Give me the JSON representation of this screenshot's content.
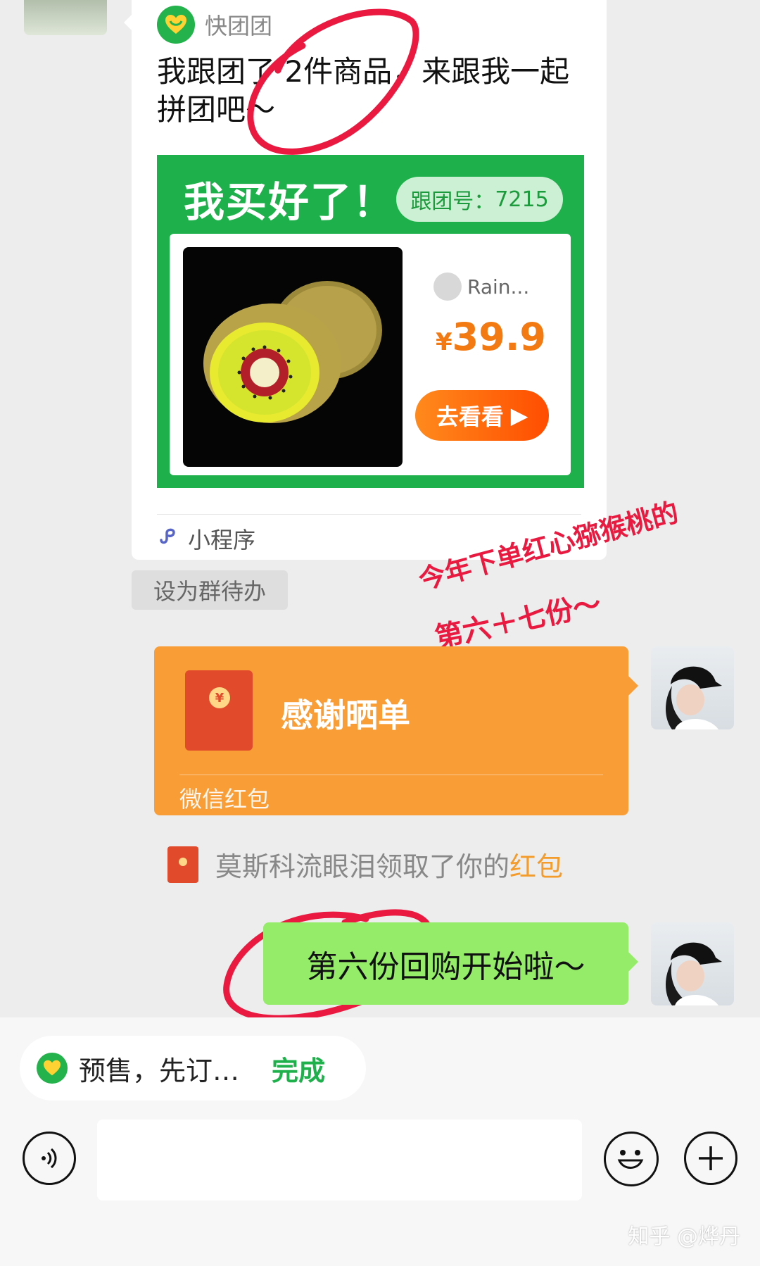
{
  "miniprogram_card": {
    "app_name": "快团团",
    "message": "我跟团了 2件商品，来跟我一起拼团吧～",
    "promo_title": "我买好了！",
    "group_number_label": "跟团号：",
    "group_number": "7215",
    "seller_name": "Rain...",
    "price_currency": "¥",
    "price": "39.9",
    "view_button": "去看看",
    "mini_program_label": "小程序",
    "product_image": "red-heart-kiwi-image"
  },
  "set_todo_label": "设为群待办",
  "annotation": {
    "line1": "今年下单红心猕猴桃的",
    "line2": "第六＋七份～",
    "color": "#e9193f"
  },
  "red_packet": {
    "title": "感谢晒单",
    "subtitle": "微信红包",
    "color": "#f99e37"
  },
  "notice": {
    "text": "莫斯科流眼泪领取了你的",
    "highlight": "红包"
  },
  "message": {
    "text": "第六份回购开始啦～"
  },
  "bottom_pill": {
    "text": "预售，先订…",
    "done_label": "完成"
  },
  "input_bar": {
    "value": "",
    "placeholder": ""
  },
  "icons": {
    "voice": "voice-icon",
    "emoji": "emoji-icon",
    "plus": "plus-icon"
  },
  "watermark": "知乎 @烨丹"
}
